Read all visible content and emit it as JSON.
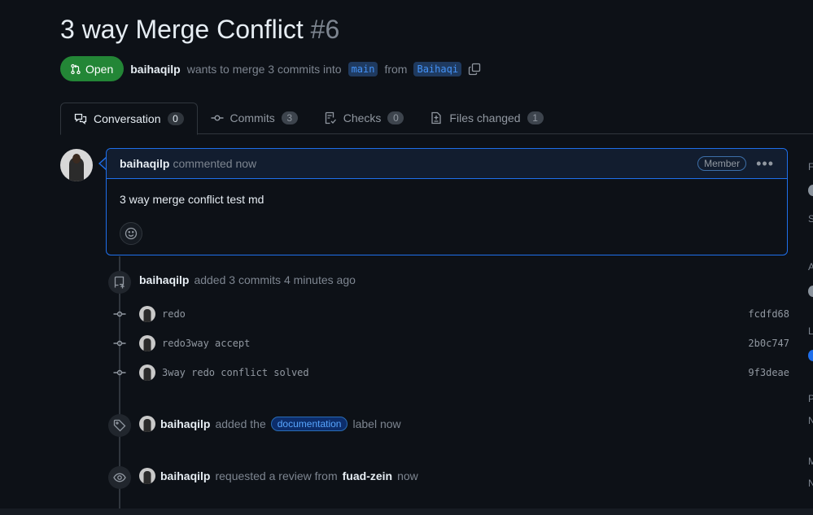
{
  "pr": {
    "title": "3 way Merge Conflict",
    "number": "#6",
    "status": "Open",
    "author": "baihaqilp",
    "merge_text": "wants to merge 3 commits into",
    "base_branch": "main",
    "from_text": "from",
    "head_branch": "Baihaqi"
  },
  "tabs": [
    {
      "label": "Conversation",
      "count": "0"
    },
    {
      "label": "Commits",
      "count": "3"
    },
    {
      "label": "Checks",
      "count": "0"
    },
    {
      "label": "Files changed",
      "count": "1"
    }
  ],
  "comment": {
    "author": "baihaqilp",
    "action": "commented now",
    "role": "Member",
    "body": "3 way merge conflict test md"
  },
  "commits_event": {
    "author": "baihaqilp",
    "text": "added 3 commits 4 minutes ago"
  },
  "commits": [
    {
      "message": "redo",
      "sha": "fcdfd68"
    },
    {
      "message": "redo3way accept",
      "sha": "2b0c747"
    },
    {
      "message": "3way redo conflict solved",
      "sha": "9f3deae"
    }
  ],
  "label_event": {
    "author": "baihaqilp",
    "prefix": "added the",
    "label": "documentation",
    "suffix": "label now"
  },
  "review_event": {
    "author": "baihaqilp",
    "prefix": "requested a review from",
    "reviewer": "fuad-zein",
    "suffix": "now"
  },
  "sidebar_stubs": [
    "F",
    "S",
    "A",
    "L",
    "P",
    "N",
    "M",
    "N"
  ],
  "colors": {
    "background": "#0d1117",
    "open_green": "#238636",
    "accent_blue": "#1f6feb",
    "border": "#30363d"
  }
}
